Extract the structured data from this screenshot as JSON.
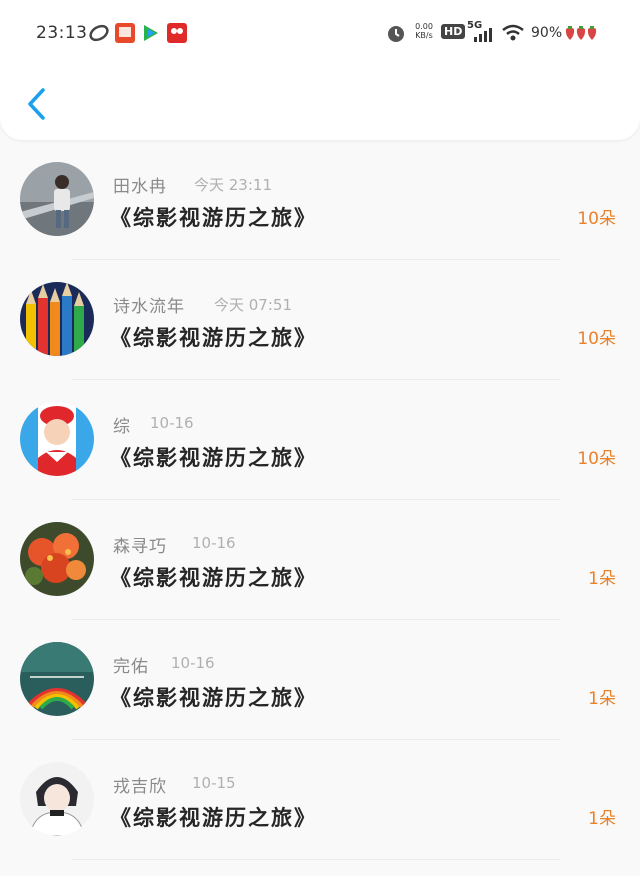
{
  "status_bar": {
    "time": "23:13",
    "net_speed_value": "0.00",
    "net_speed_unit": "KB/s",
    "hd": "HD",
    "network": "5G",
    "battery": "90%"
  },
  "header": {
    "back_icon": "chevron-left-icon"
  },
  "colors": {
    "accent": "#1aa0f0",
    "amount": "#e8822c"
  },
  "gifts": [
    {
      "name": "田水冉",
      "time": "今天 23:11",
      "title": "《综影视游历之旅》",
      "amount": "10朵",
      "avatar": "boy-escalator"
    },
    {
      "name": "诗水流年",
      "time": "今天 07:51",
      "title": "《综影视游历之旅》",
      "amount": "10朵",
      "avatar": "colored-pencils"
    },
    {
      "name": "综",
      "time": "10-16",
      "title": "《综影视游历之旅》",
      "amount": "10朵",
      "avatar": "baby-red-hat"
    },
    {
      "name": "森寻巧",
      "time": "10-16",
      "title": "《综影视游历之旅》",
      "amount": "1朵",
      "avatar": "flowers"
    },
    {
      "name": "完佑",
      "time": "10-16",
      "title": "《综影视游历之旅》",
      "amount": "1朵",
      "avatar": "rainbow"
    },
    {
      "name": "戎吉欣",
      "time": "10-15",
      "title": "《综影视游历之旅》",
      "amount": "1朵",
      "avatar": "anime-boy"
    }
  ]
}
